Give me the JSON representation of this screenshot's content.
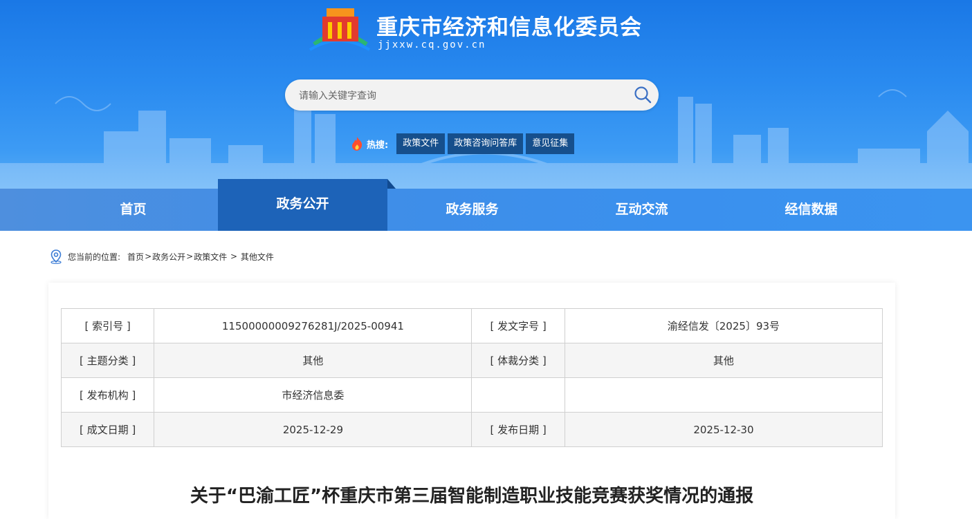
{
  "header": {
    "site_title": "重庆市经济和信息化委员会",
    "site_domain": "jjxxw.cq.gov.cn"
  },
  "search": {
    "placeholder": "请输入关键字查询"
  },
  "hot": {
    "label": "热搜:",
    "tags": [
      "政策文件",
      "政策咨询问答库",
      "意见征集"
    ]
  },
  "nav": {
    "items": [
      "首页",
      "政务公开",
      "政务服务",
      "互动交流",
      "经信数据"
    ],
    "active": "政务公开"
  },
  "breadcrumb": {
    "prefix": "您当前的位置:",
    "items": [
      "首页",
      "政务公开",
      "政策文件",
      "其他文件"
    ],
    "separators": [
      ">",
      ">",
      " > "
    ]
  },
  "meta_table": {
    "rows": [
      [
        {
          "key": "[ 索引号 ]",
          "value": "11500000009276281J/2025-00941"
        },
        {
          "key": "[ 发文字号 ]",
          "value": "渝经信发〔2025〕93号"
        }
      ],
      [
        {
          "key": "[ 主题分类 ]",
          "value": "其他"
        },
        {
          "key": "[ 体裁分类 ]",
          "value": "其他"
        }
      ],
      [
        {
          "key": "[ 发布机构 ]",
          "value": "市经济信息委"
        },
        {
          "key": "",
          "value": ""
        }
      ],
      [
        {
          "key": "[ 成文日期 ]",
          "value": "2025-12-29"
        },
        {
          "key": "[ 发布日期 ]",
          "value": "2025-12-30"
        }
      ]
    ]
  },
  "document": {
    "title": "关于“巴渝工匠”杯重庆市第三届智能制造职业技能竞赛获奖情况的通报"
  },
  "colors": {
    "nav_active": "#1d63b8",
    "hot_tag_bg": "#164f8c",
    "banner_top": "#1a78e6"
  }
}
